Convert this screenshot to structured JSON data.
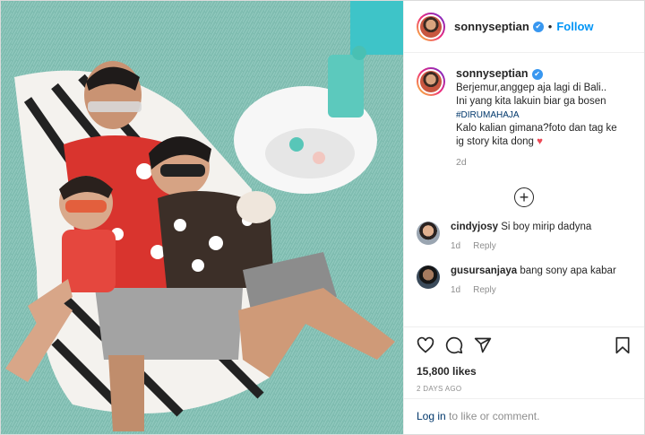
{
  "header": {
    "username": "sonnyseptian",
    "verified_icon": "verified-badge-icon",
    "separator": "•",
    "follow_label": "Follow"
  },
  "caption": {
    "username": "sonnyseptian",
    "line1": "Berjemur,anggep aja lagi di Bali..",
    "line2": "Ini yang kita lakuin biar ga bosen",
    "hashtag": "#DIRUMAHAJA",
    "line3": "Kalo kalian gimana?foto dan tag ke",
    "line4": "ig story kita dong",
    "heart": "♥",
    "time": "2d"
  },
  "load_more": "+",
  "comments": [
    {
      "username": "cindyjosy",
      "text": "Si boy mirip dadyna",
      "time": "1d",
      "reply": "Reply"
    },
    {
      "username": "gusursanjaya",
      "text": "bang sony apa kabar",
      "time": "1d",
      "reply": "Reply"
    }
  ],
  "actions": {
    "likes": "15,800 likes",
    "posted_ago": "2 DAYS AGO"
  },
  "login": {
    "link": "Log in",
    "rest": " to like or comment."
  },
  "colors": {
    "accent": "#0095f6",
    "verified": "#3897f0",
    "heart": "#ed4956",
    "muted": "#8e8e8e"
  }
}
